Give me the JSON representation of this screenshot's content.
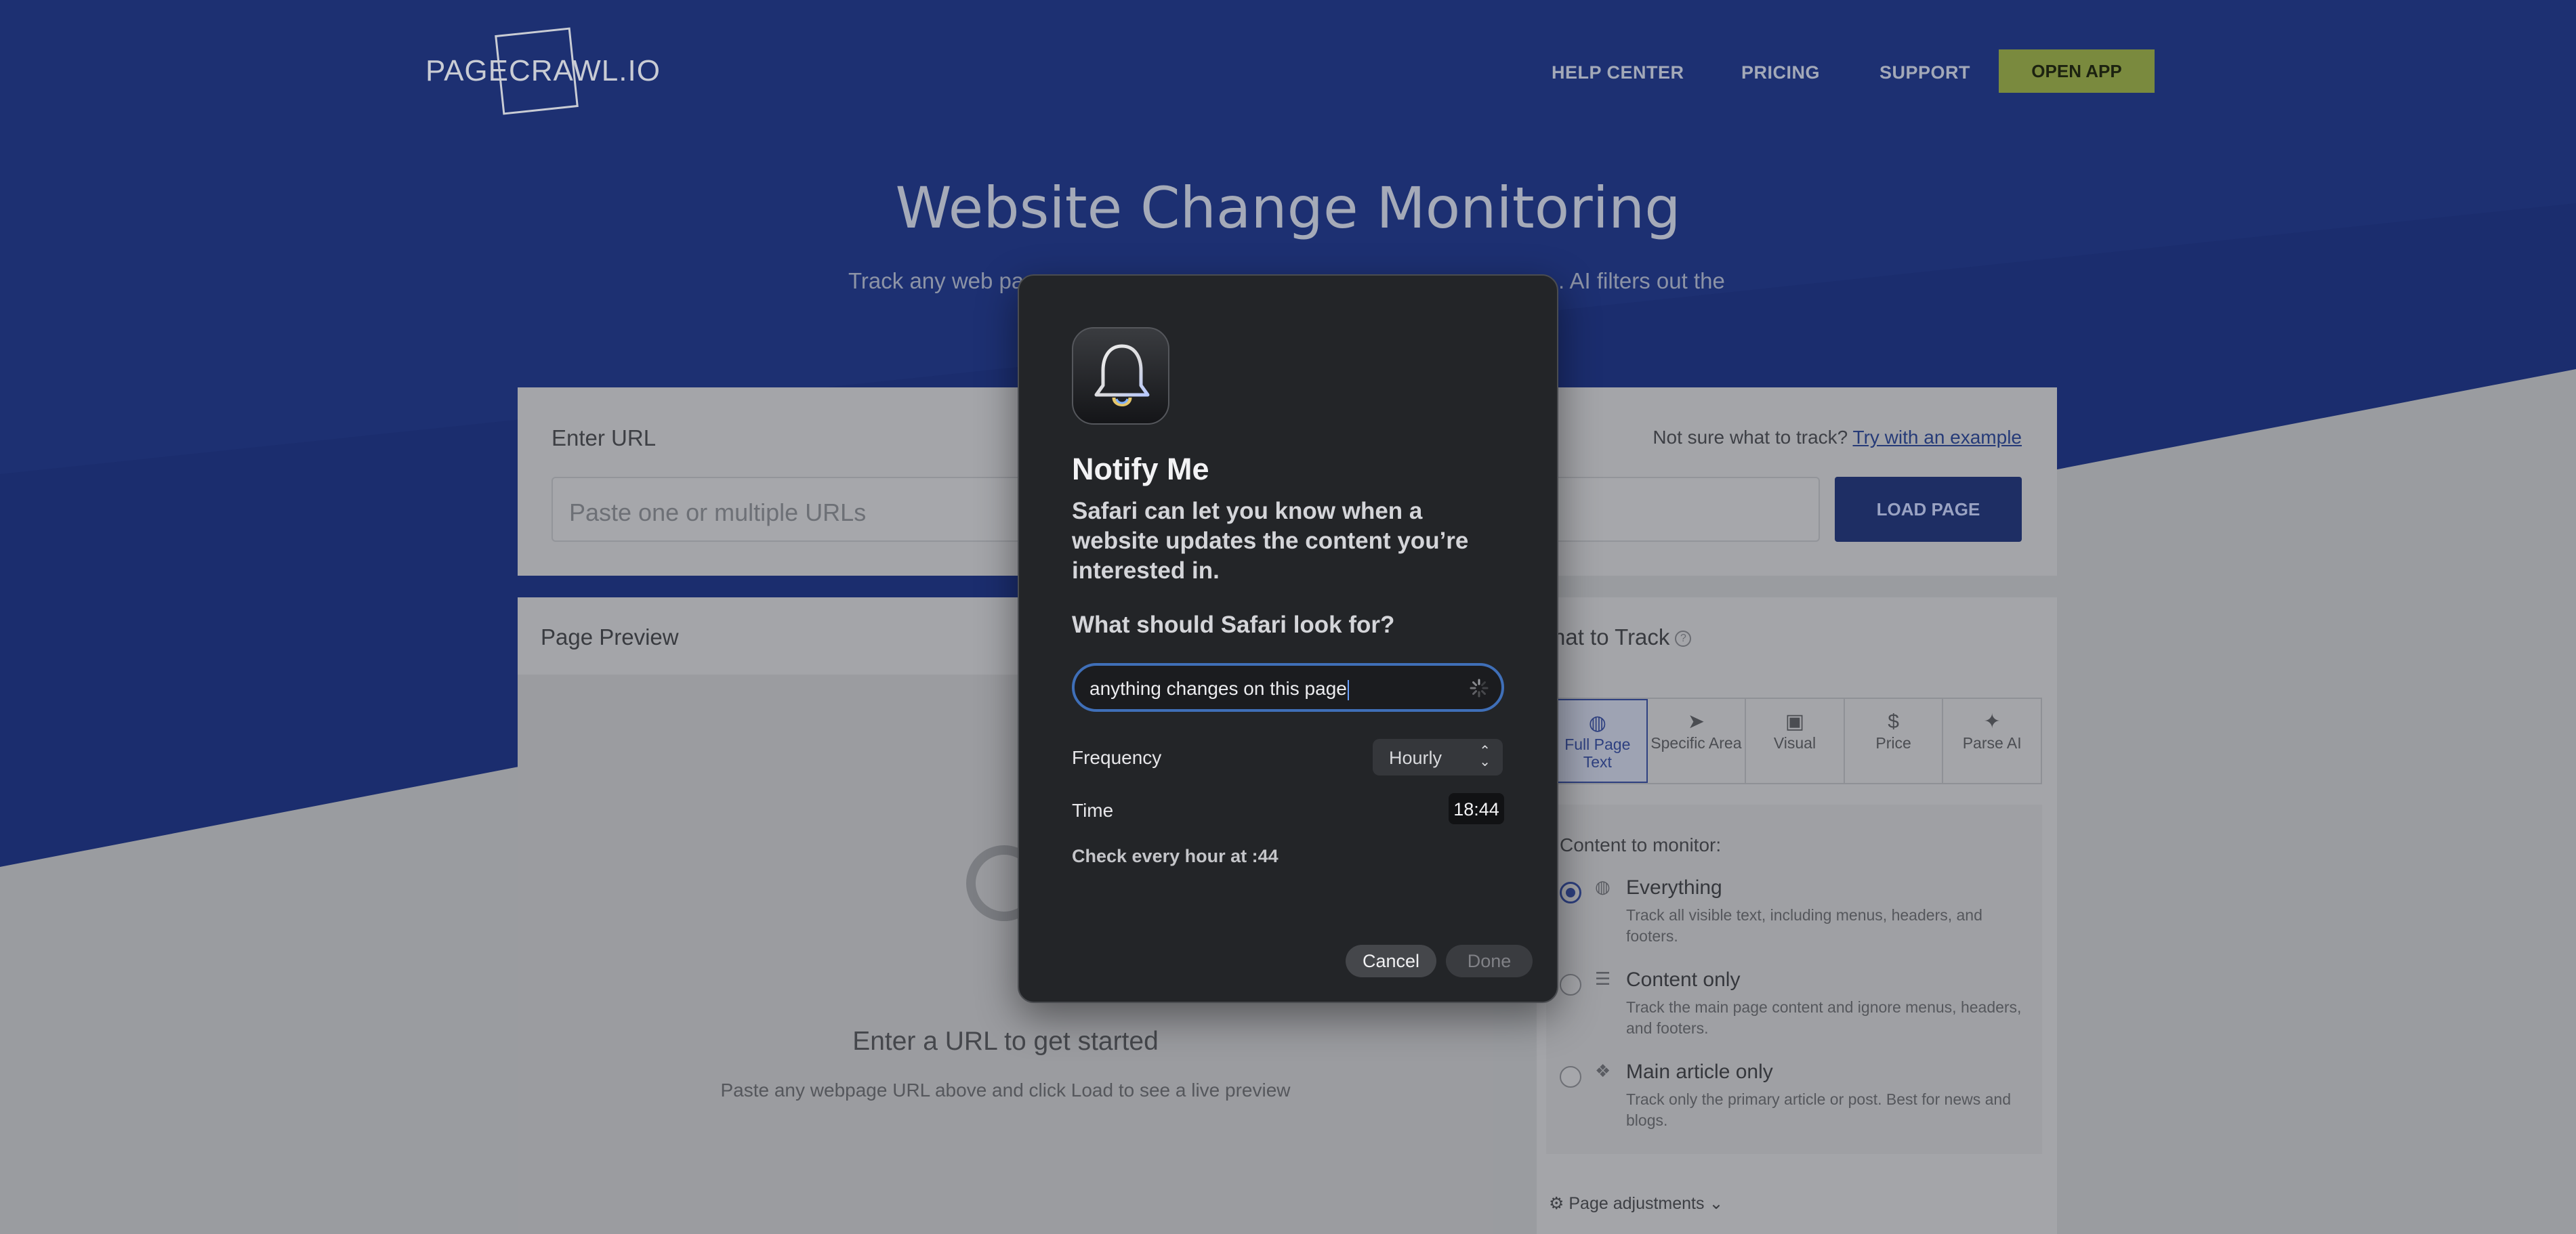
{
  "site": {
    "logo_text": "PAGECRAWL.IO",
    "nav": [
      "HELP CENTER",
      "PRICING",
      "SUPPORT"
    ],
    "open_app": "OPEN APP",
    "hero_title": "Website Change Monitoring",
    "hero_sub_left": "Track any web pa",
    "hero_sub_right": ". AI filters out the"
  },
  "url_card": {
    "label": "Enter URL",
    "placeholder": "Paste one or multiple URLs",
    "not_sure": "Not sure what to track?",
    "example_link": "Try with an example",
    "load_button": "LOAD PAGE"
  },
  "preview": {
    "title": "Page Preview",
    "message": "Enter a URL to get started",
    "sub": "Paste any webpage URL above and click Load to see a live preview"
  },
  "track": {
    "title": "hat to Track",
    "tabs": [
      {
        "icon": "◍",
        "label": "Full Page Text"
      },
      {
        "icon": "➤",
        "label": "Specific Area"
      },
      {
        "icon": "▣",
        "label": "Visual"
      },
      {
        "icon": "$",
        "label": "Price"
      },
      {
        "icon": "✦",
        "label": "Parse AI"
      }
    ],
    "content_label": "Content to monitor:",
    "options": [
      {
        "title": "Everything",
        "desc": "Track all visible text, including menus, headers, and footers.",
        "selected": true
      },
      {
        "title": "Content only",
        "desc": "Track the main page content and ignore menus, headers, and footers.",
        "selected": false
      },
      {
        "title": "Main article only",
        "desc": "Track only the primary article or post. Best for news and blogs.",
        "selected": false
      }
    ],
    "page_adjustments": "Page adjustments"
  },
  "modal": {
    "title": "Notify Me",
    "description": "Safari can let you know when a website updates the content you’re interested in.",
    "question": "What should Safari look for?",
    "input_value": "anything changes on this page",
    "frequency_label": "Frequency",
    "frequency_value": "Hourly",
    "time_label": "Time",
    "time_value": "18:44",
    "check_text": "Check every hour at :44",
    "cancel": "Cancel",
    "done": "Done"
  },
  "colors": {
    "hero_blue": "#1b2d6e",
    "accent": "#3f6fb8",
    "modal_bg": "#232528"
  }
}
